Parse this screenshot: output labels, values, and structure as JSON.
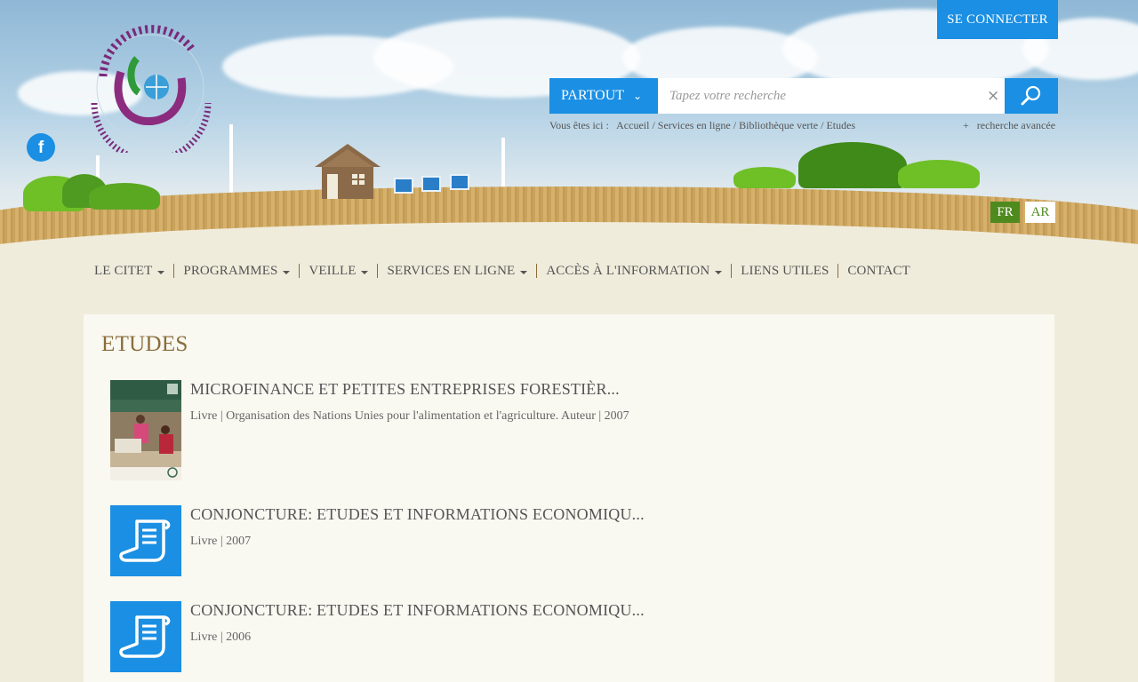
{
  "header": {
    "connect_label": "SE CONNECTER",
    "facebook_glyph": "f",
    "logo_alt": "Centre International des Technologies de l'Environnement de Tunis"
  },
  "search": {
    "scope_label": "PARTOUT",
    "placeholder": "Tapez votre recherche",
    "clear_glyph": "×",
    "advanced_label": "+   recherche avancée"
  },
  "breadcrumb": {
    "prefix": "Vous êtes ici :",
    "items": [
      "Accueil",
      "Services en ligne",
      "Bibliothèque verte",
      "Etudes"
    ],
    "separator": " / "
  },
  "languages": {
    "fr": "FR",
    "ar": "AR"
  },
  "nav": {
    "items": [
      {
        "label": "LE CITET",
        "dropdown": true
      },
      {
        "label": "PROGRAMMES",
        "dropdown": true
      },
      {
        "label": "VEILLE",
        "dropdown": true
      },
      {
        "label": "SERVICES EN LIGNE",
        "dropdown": true
      },
      {
        "label": "ACCÈS À L'INFORMATION",
        "dropdown": true
      },
      {
        "label": "LIENS UTILES",
        "dropdown": false
      },
      {
        "label": "CONTACT",
        "dropdown": false
      }
    ]
  },
  "main": {
    "title": "ETUDES",
    "items": [
      {
        "title": "MICROFINANCE ET PETITES ENTREPRISES FORESTIÈR...",
        "meta": "Livre | Organisation des Nations Unies pour l'alimentation et l'agriculture. Auteur | 2007",
        "thumb": "cover",
        "cover_text": "Microfinance et petites entreprises forestières"
      },
      {
        "title": "CONJONCTURE: ETUDES ET INFORMATIONS ECONOMIQU...",
        "meta": "Livre | 2007",
        "thumb": "document-icon"
      },
      {
        "title": "CONJONCTURE: ETUDES ET INFORMATIONS ECONOMIQU...",
        "meta": "Livre | 2006",
        "thumb": "document-icon"
      }
    ]
  },
  "colors": {
    "accent": "#1a8fe3",
    "brand_brown": "#8a6d3b",
    "lang_green": "#4f8a1e"
  }
}
